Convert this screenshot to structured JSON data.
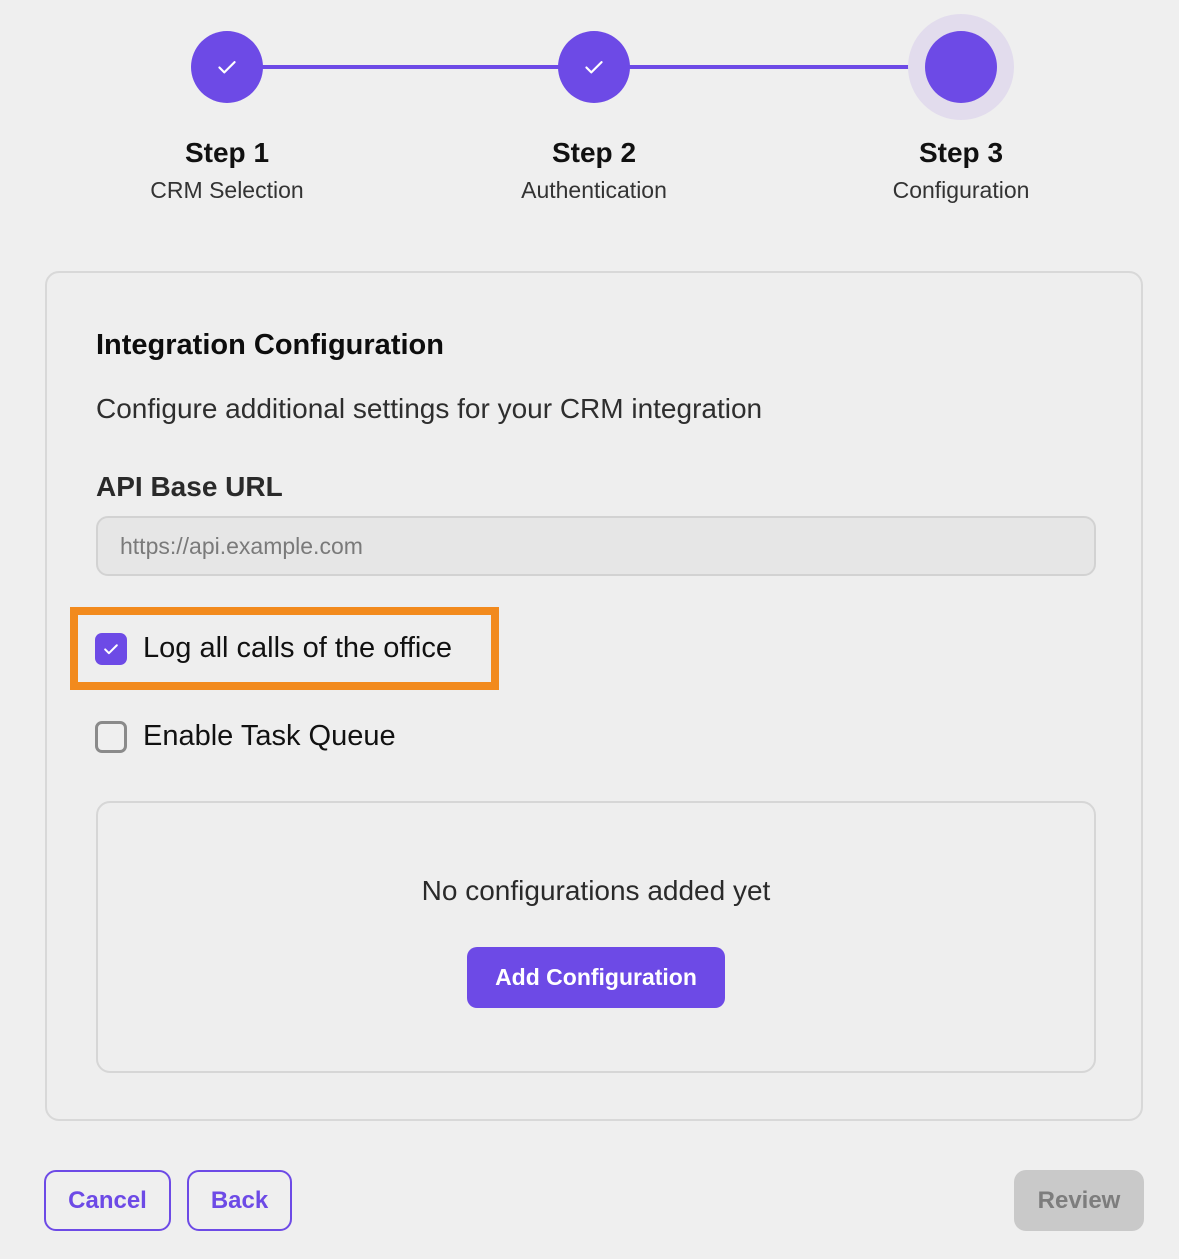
{
  "stepper": {
    "steps": [
      {
        "title": "Step 1",
        "subtitle": "CRM Selection",
        "state": "completed"
      },
      {
        "title": "Step 2",
        "subtitle": "Authentication",
        "state": "completed"
      },
      {
        "title": "Step 3",
        "subtitle": "Configuration",
        "state": "current"
      }
    ],
    "accent_color": "#6d4ae6"
  },
  "card": {
    "title": "Integration Configuration",
    "description": "Configure additional settings for your CRM integration",
    "api_url": {
      "label": "API Base URL",
      "value": "",
      "placeholder": "https://api.example.com"
    },
    "options": [
      {
        "label": "Log all calls of the office",
        "checked": true,
        "highlighted": true
      },
      {
        "label": "Enable Task Queue",
        "checked": false,
        "highlighted": false
      }
    ],
    "configurations": {
      "empty_text": "No configurations added yet",
      "add_label": "Add Configuration"
    }
  },
  "footer": {
    "cancel_label": "Cancel",
    "back_label": "Back",
    "review_label": "Review",
    "review_disabled": true
  },
  "colors": {
    "highlight": "#f28a1d",
    "disabled": "#c9c9c9"
  }
}
